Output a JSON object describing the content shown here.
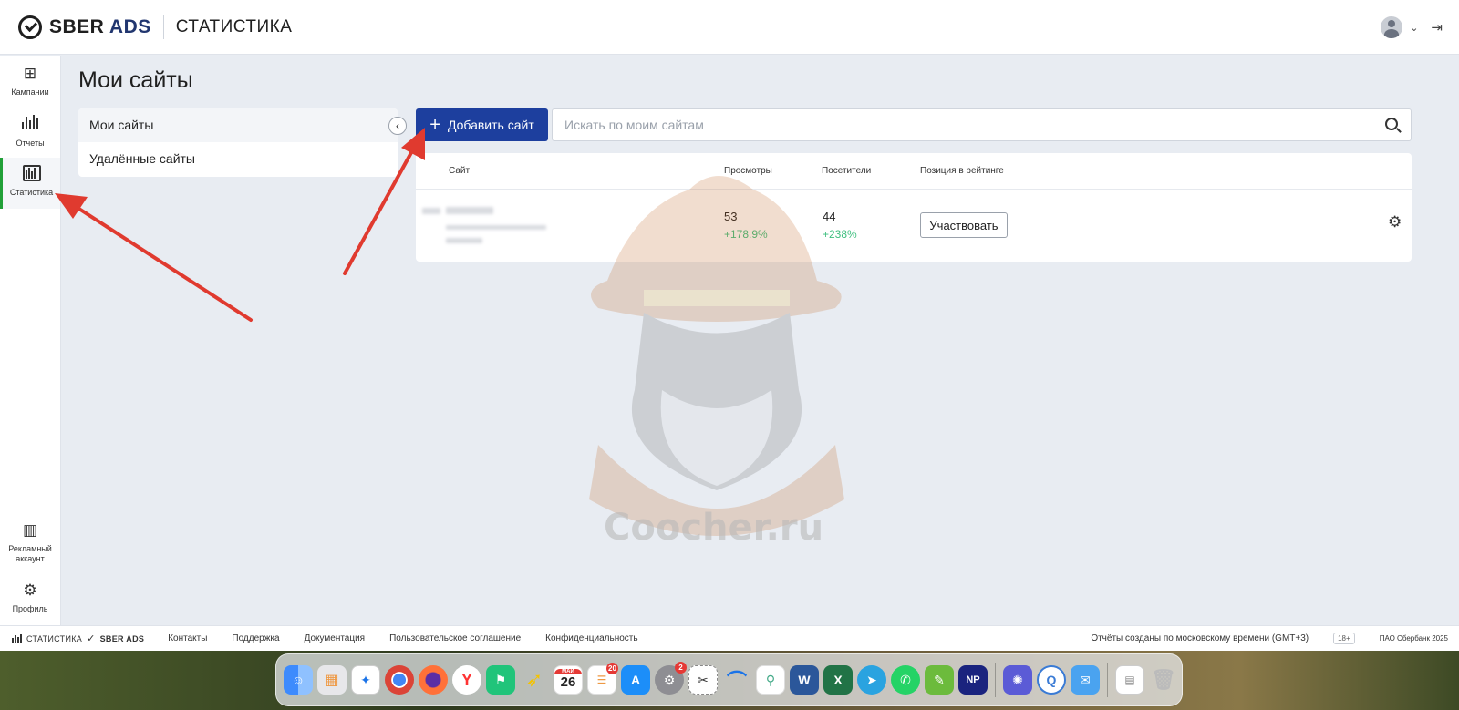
{
  "header": {
    "logo_sber": "SBER",
    "logo_ads": "ADS",
    "section_title": "СТАТИСТИКА"
  },
  "sidebar": {
    "items": [
      {
        "label": "Кампании",
        "icon": "campaign-add-icon"
      },
      {
        "label": "Отчеты",
        "icon": "bar-chart-icon"
      },
      {
        "label": "Статистика",
        "icon": "statistics-icon",
        "active": true
      },
      {
        "label": "Рекламный аккаунт",
        "icon": "ad-account-icon"
      },
      {
        "label": "Профиль",
        "icon": "gear-icon"
      }
    ]
  },
  "page": {
    "title": "Мои сайты"
  },
  "filters": {
    "items": [
      "Мои сайты",
      "Удалённые сайты"
    ],
    "active_index": 0
  },
  "toolbar": {
    "add_button_label": "Добавить сайт",
    "search_placeholder": "Искать по моим сайтам"
  },
  "table": {
    "columns": [
      "Сайт",
      "Просмотры",
      "Посетители",
      "Позиция в рейтинге"
    ],
    "rows": [
      {
        "views": "53",
        "views_delta": "+178.9%",
        "visitors": "44",
        "visitors_delta": "+238%",
        "rating_button": "Участвовать"
      }
    ]
  },
  "watermark": {
    "text": "Coocher.ru"
  },
  "footer": {
    "brand_section": "СТАТИСТИКА",
    "brand_logo": "SBER ADS",
    "links": [
      "Контакты",
      "Поддержка",
      "Документация",
      "Пользовательское соглашение",
      "Конфиденциальность"
    ],
    "timezone_note": "Отчёты созданы по московскому времени (GMT+3)",
    "age_rating": "18+",
    "copyright": "ПАО Сбербанк 2025"
  },
  "dock": {
    "calendar_month": "МАЙ",
    "calendar_day": "26",
    "reminders_badge": "20",
    "settings_badge": "2",
    "apps": [
      "finder-icon",
      "launchpad-icon",
      "safari-icon",
      "chrome-icon",
      "firefox-icon",
      "yandex-icon",
      "flag-app-icon",
      "yellow-app-icon",
      "calendar-icon",
      "reminders-icon",
      "app-store-icon",
      "settings-icon",
      "screenshot-icon",
      "blue-wave-icon",
      "scooter-icon",
      "word-icon",
      "excel-icon",
      "telegram-icon",
      "whatsapp-icon",
      "note-icon",
      "np-icon",
      "gear-app-icon",
      "quicktime-icon",
      "mail-icon",
      "preview-icon",
      "trash-icon"
    ],
    "np_label": "NP"
  },
  "colors": {
    "primary_button": "#1d3f9e",
    "active_nav_accent": "#21a038",
    "delta_positive": "#3fbf7f",
    "annotation_arrow": "#e03a2f"
  }
}
